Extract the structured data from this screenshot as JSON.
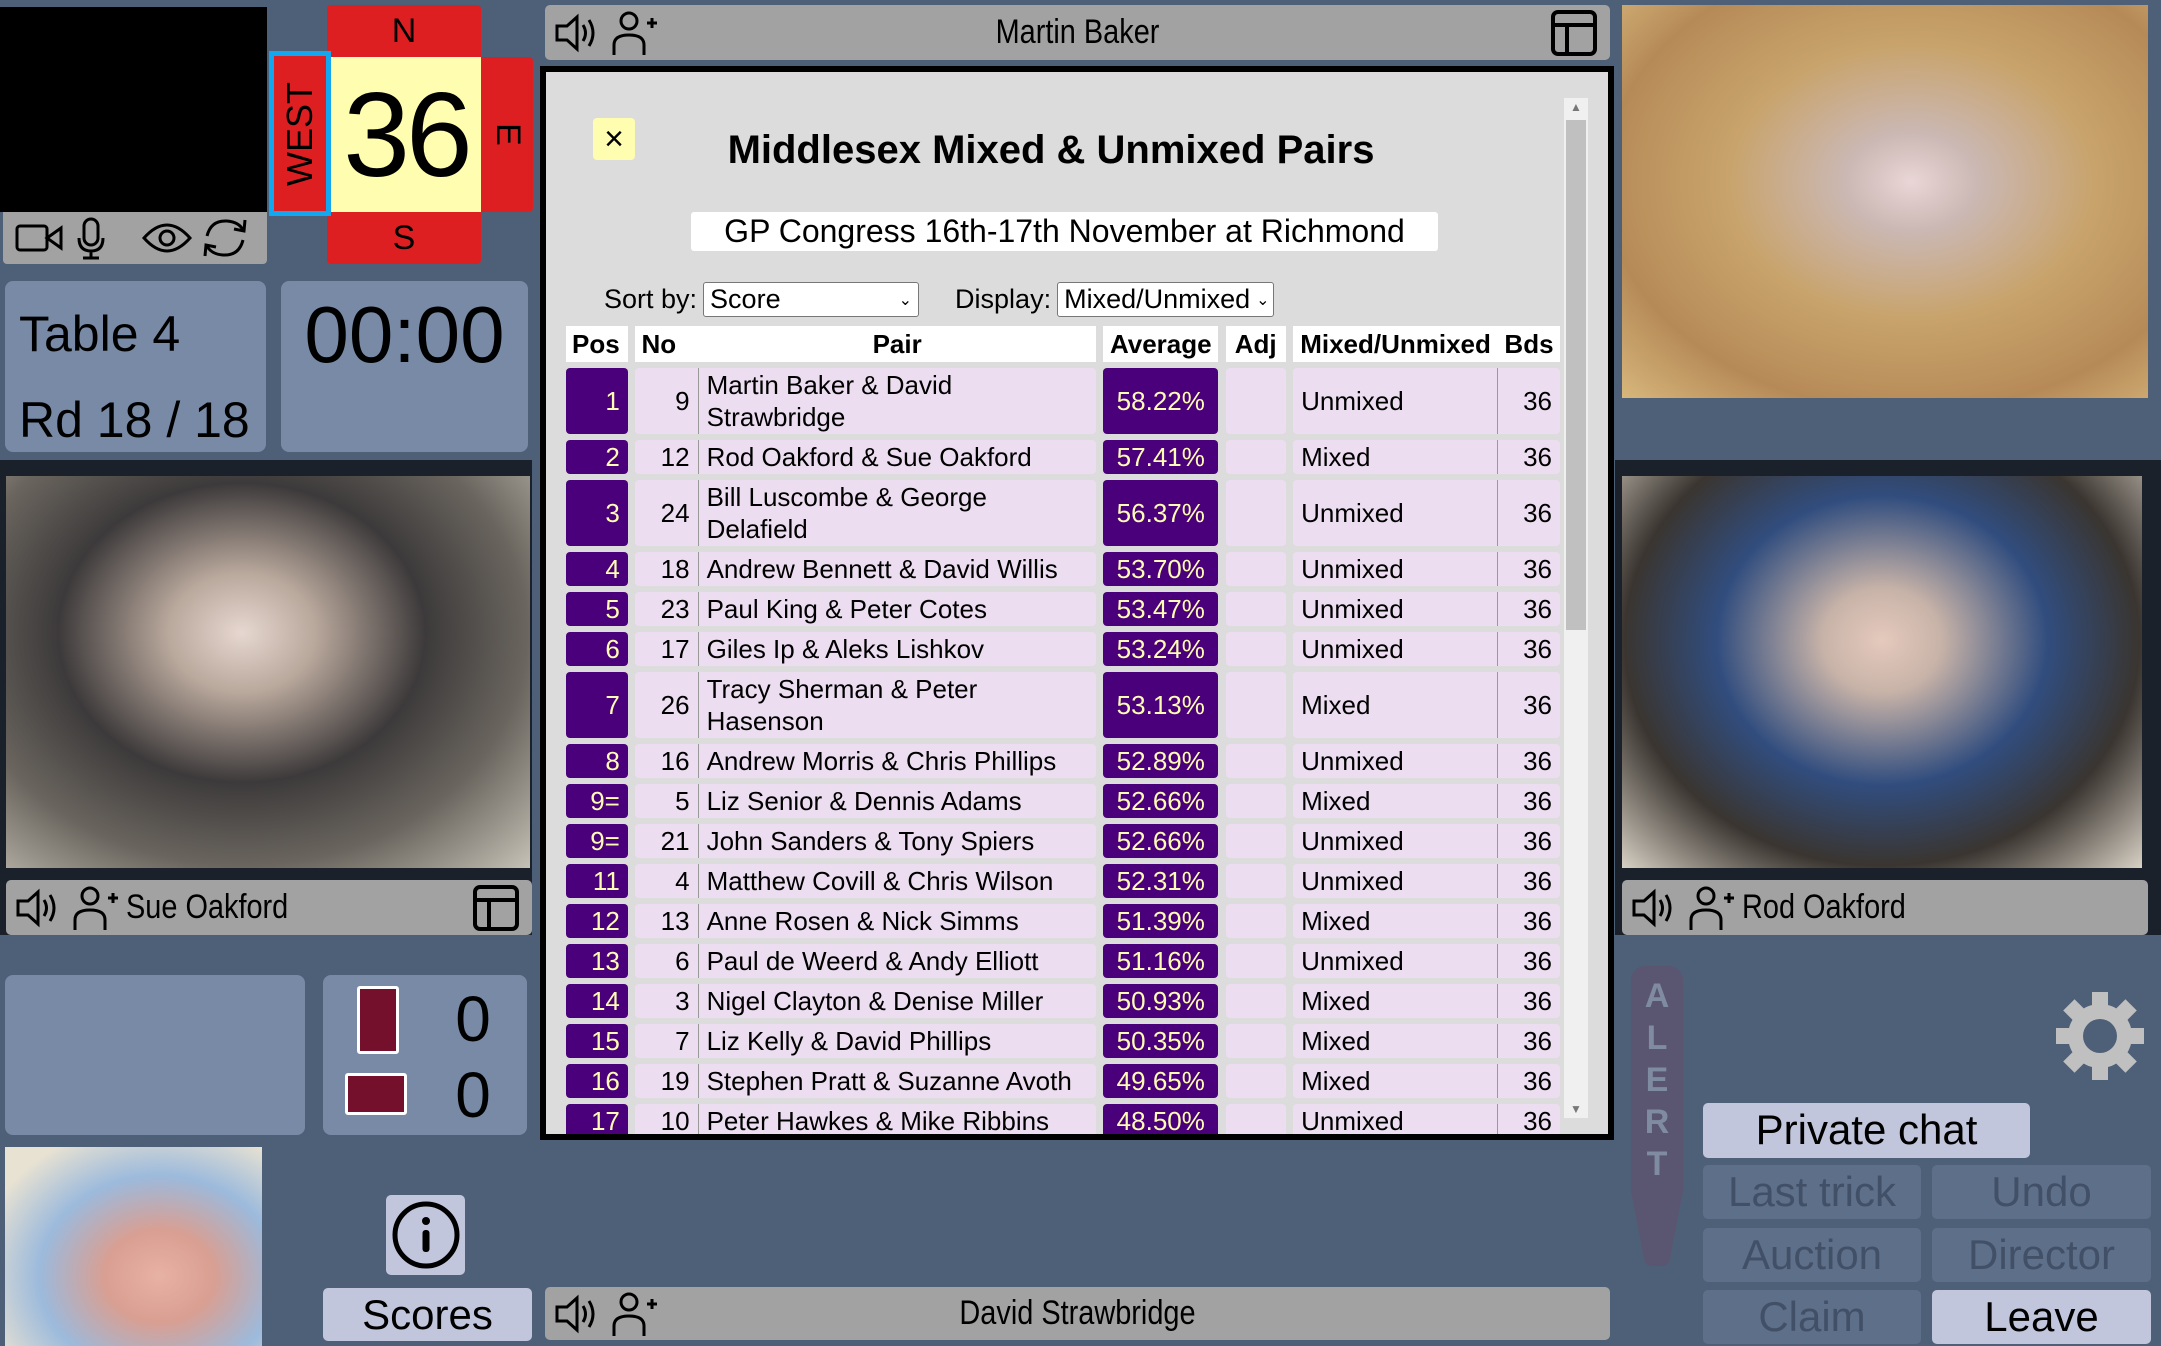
{
  "self": {
    "toolbar_icons": [
      "video-camera-icon",
      "microphone-icon",
      "eye-icon",
      "refresh-icon"
    ]
  },
  "compass": {
    "north": "N",
    "south": "S",
    "east": "E",
    "west": "WEST",
    "board_number": "36",
    "highlight_color": "#13a7ef",
    "vulnerable_color": "#dd1f22"
  },
  "table_info": {
    "table": "Table 4",
    "round": "Rd 18 / 18"
  },
  "timer": "00:00",
  "players": {
    "north": "Martin Baker",
    "south": "David Strawbridge",
    "west": "Sue Oakford",
    "east": "Rod Oakford"
  },
  "tricks": {
    "ns": "0",
    "ew": "0"
  },
  "buttons": {
    "scores": "Scores",
    "private_chat": "Private chat",
    "last_trick": "Last trick",
    "undo": "Undo",
    "auction": "Auction",
    "director": "Director",
    "claim": "Claim",
    "leave": "Leave",
    "alert": "ALERT"
  },
  "modal": {
    "close": "×",
    "title": "Middlesex Mixed & Unmixed Pairs",
    "subtitle": "GP Congress 16th-17th November at Richmond",
    "sort_label": "Sort by:",
    "sort_value": "Score",
    "display_label": "Display:",
    "display_value": "Mixed/Unmixed",
    "columns": [
      "Pos",
      "No",
      "Pair",
      "Average",
      "Adj",
      "Mixed/Unmixed",
      "Bds"
    ],
    "rows": [
      {
        "pos": "1",
        "no": "9",
        "pair": "Martin Baker & David Strawbridge",
        "avg": "58.22%",
        "adj": "",
        "type": "Unmixed",
        "bds": "36"
      },
      {
        "pos": "2",
        "no": "12",
        "pair": "Rod Oakford & Sue Oakford",
        "avg": "57.41%",
        "adj": "",
        "type": "Mixed",
        "bds": "36"
      },
      {
        "pos": "3",
        "no": "24",
        "pair": "Bill Luscombe & George Delafield",
        "avg": "56.37%",
        "adj": "",
        "type": "Unmixed",
        "bds": "36"
      },
      {
        "pos": "4",
        "no": "18",
        "pair": "Andrew Bennett & David Willis",
        "avg": "53.70%",
        "adj": "",
        "type": "Unmixed",
        "bds": "36"
      },
      {
        "pos": "5",
        "no": "23",
        "pair": "Paul King & Peter Cotes",
        "avg": "53.47%",
        "adj": "",
        "type": "Unmixed",
        "bds": "36"
      },
      {
        "pos": "6",
        "no": "17",
        "pair": "Giles Ip & Aleks Lishkov",
        "avg": "53.24%",
        "adj": "",
        "type": "Unmixed",
        "bds": "36"
      },
      {
        "pos": "7",
        "no": "26",
        "pair": "Tracy Sherman & Peter Hasenson",
        "avg": "53.13%",
        "adj": "",
        "type": "Mixed",
        "bds": "36"
      },
      {
        "pos": "8",
        "no": "16",
        "pair": "Andrew Morris & Chris Phillips",
        "avg": "52.89%",
        "adj": "",
        "type": "Unmixed",
        "bds": "36"
      },
      {
        "pos": "9=",
        "no": "5",
        "pair": "Liz Senior & Dennis Adams",
        "avg": "52.66%",
        "adj": "",
        "type": "Mixed",
        "bds": "36"
      },
      {
        "pos": "9=",
        "no": "21",
        "pair": "John Sanders & Tony Spiers",
        "avg": "52.66%",
        "adj": "",
        "type": "Unmixed",
        "bds": "36"
      },
      {
        "pos": "11",
        "no": "4",
        "pair": "Matthew Covill & Chris Wilson",
        "avg": "52.31%",
        "adj": "",
        "type": "Unmixed",
        "bds": "36"
      },
      {
        "pos": "12",
        "no": "13",
        "pair": "Anne Rosen & Nick Simms",
        "avg": "51.39%",
        "adj": "",
        "type": "Mixed",
        "bds": "36"
      },
      {
        "pos": "13",
        "no": "6",
        "pair": "Paul de Weerd & Andy Elliott",
        "avg": "51.16%",
        "adj": "",
        "type": "Unmixed",
        "bds": "36"
      },
      {
        "pos": "14",
        "no": "3",
        "pair": "Nigel Clayton & Denise Miller",
        "avg": "50.93%",
        "adj": "",
        "type": "Mixed",
        "bds": "36"
      },
      {
        "pos": "15",
        "no": "7",
        "pair": "Liz Kelly & David Phillips",
        "avg": "50.35%",
        "adj": "",
        "type": "Mixed",
        "bds": "36"
      },
      {
        "pos": "16",
        "no": "19",
        "pair": "Stephen Pratt & Suzanne Avoth",
        "avg": "49.65%",
        "adj": "",
        "type": "Mixed",
        "bds": "36"
      },
      {
        "pos": "17",
        "no": "10",
        "pair": "Peter Hawkes & Mike Ribbins",
        "avg": "48.50%",
        "adj": "",
        "type": "Unmixed",
        "bds": "36"
      }
    ],
    "highlight_color": "#4a007b",
    "row_color": "#ecdef0"
  }
}
